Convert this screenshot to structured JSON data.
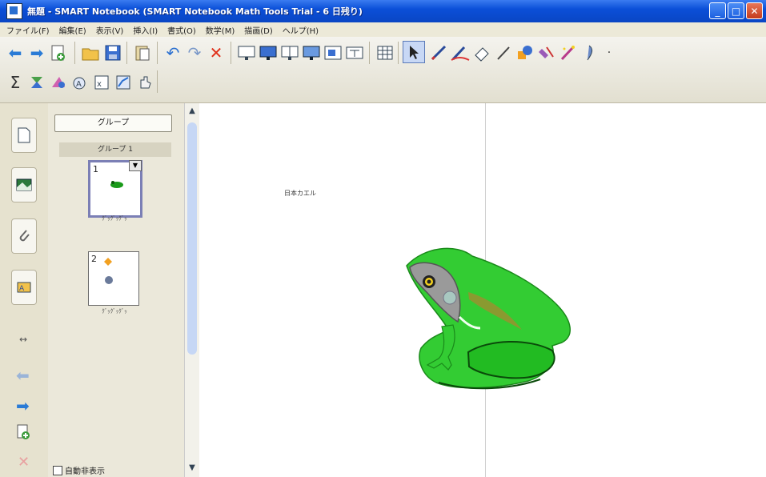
{
  "window": {
    "title": "無題 - SMART Notebook (SMART Notebook Math Tools Trial - 6 日残り)",
    "icon": "notebook-app-icon",
    "buttons": {
      "minimize": "_",
      "maximize": "□",
      "close": "✕"
    }
  },
  "menu": [
    "ファイル(F)",
    "編集(E)",
    "表示(V)",
    "挿入(I)",
    "書式(O)",
    "数学(M)",
    "描画(D)",
    "ヘルプ(H)"
  ],
  "side_tabs": [
    "page-sorter-tab-icon",
    "gallery-tab-icon",
    "attachments-tab-icon",
    "properties-tab-icon"
  ],
  "sorter": {
    "group_button": "グループ",
    "group_label": "グループ 1",
    "pages": [
      {
        "number": "1",
        "caption": "ｸﾞｯｸﾞｯｸﾞｯ"
      },
      {
        "number": "2",
        "caption": "ｸﾞｯｸﾞｯｸﾞｯ"
      }
    ],
    "autohide": "自動非表示"
  },
  "canvas": {
    "text": "日本カエル"
  },
  "colors": {
    "frog_green": "#33cc33",
    "frog_dark": "#1a7a1a",
    "titlebar": "#0b4fd8"
  }
}
